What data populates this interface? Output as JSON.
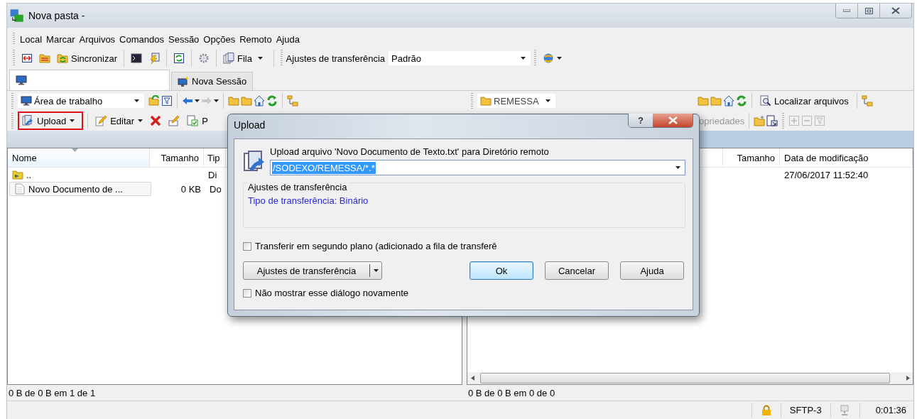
{
  "window": {
    "title": "Nova pasta -"
  },
  "menu": [
    {
      "label": "Local"
    },
    {
      "label": "Marcar"
    },
    {
      "label": "Arquivos"
    },
    {
      "label": "Comandos"
    },
    {
      "label": "Sessão"
    },
    {
      "label": "Opções"
    },
    {
      "label": "Remoto"
    },
    {
      "label": "Ajuda"
    }
  ],
  "toolbar": {
    "sync_label": "Sincronizar",
    "queue_label": "Fila",
    "transfer_settings_label": "Ajustes de transferência",
    "transfer_preset": "Padrão"
  },
  "session_tabs": [
    {
      "kind": "local",
      "selected": true
    },
    {
      "kind": "new",
      "label": "Nova Sessão",
      "selected": false
    }
  ],
  "left_panel": {
    "location": "Área de trabalho",
    "actions": [
      {
        "kind": "upload",
        "label": "Upload",
        "menu": true,
        "highlighted": true
      },
      {
        "kind": "edit",
        "label": "Editar",
        "menu": true,
        "highlighted": false
      },
      {
        "kind": "delete",
        "menu": false,
        "highlighted": false
      },
      {
        "kind": "rename",
        "menu": false,
        "highlighted": false
      },
      {
        "kind": "properties",
        "label": "P",
        "menu": false,
        "highlighted": false
      }
    ],
    "columns": [
      "Nome",
      "Tamanho",
      "Tip"
    ],
    "rows": [
      {
        "kind": "parent",
        "name": "..",
        "type": "Di"
      },
      {
        "kind": "file",
        "name": "Novo Documento de ...",
        "size": "0 KB",
        "type": "Do"
      }
    ],
    "status": "0 B de 0 B em 1 de 1"
  },
  "right_panel": {
    "location": "REMESSA",
    "find_label": "Localizar arquivos",
    "properties_label": "opriedades",
    "columns": [
      "Tamanho",
      "Data de modificação"
    ],
    "rows": [
      {
        "modified": "27/06/2017 11:52:40"
      }
    ],
    "status": "0 B de 0 B em 0 de 0"
  },
  "status_bar": {
    "protocol": "SFTP-3",
    "elapsed": "0:01:36"
  },
  "dialog": {
    "title": "Upload",
    "help_label": "?",
    "prompt": "Upload arquivo 'Novo Documento de Texto.txt' para Diretório remoto",
    "target": {
      "value": "/SODEXO/REMESSA/*.*",
      "selected": true
    },
    "group": {
      "title": "Ajustes de transferência",
      "text": "Tipo de transferência: Binário"
    },
    "options": [
      {
        "label": "Transferir em segundo plano (adicionado a fila de transferê",
        "checked": false
      },
      {
        "label": "Não mostrar esse diálogo novamente",
        "checked": false
      }
    ],
    "split_button": "Ajustes de transferência",
    "buttons": [
      {
        "label": "Ok",
        "default": true
      },
      {
        "label": "Cancelar",
        "default": false
      },
      {
        "label": "Ajuda",
        "default": false
      }
    ]
  }
}
